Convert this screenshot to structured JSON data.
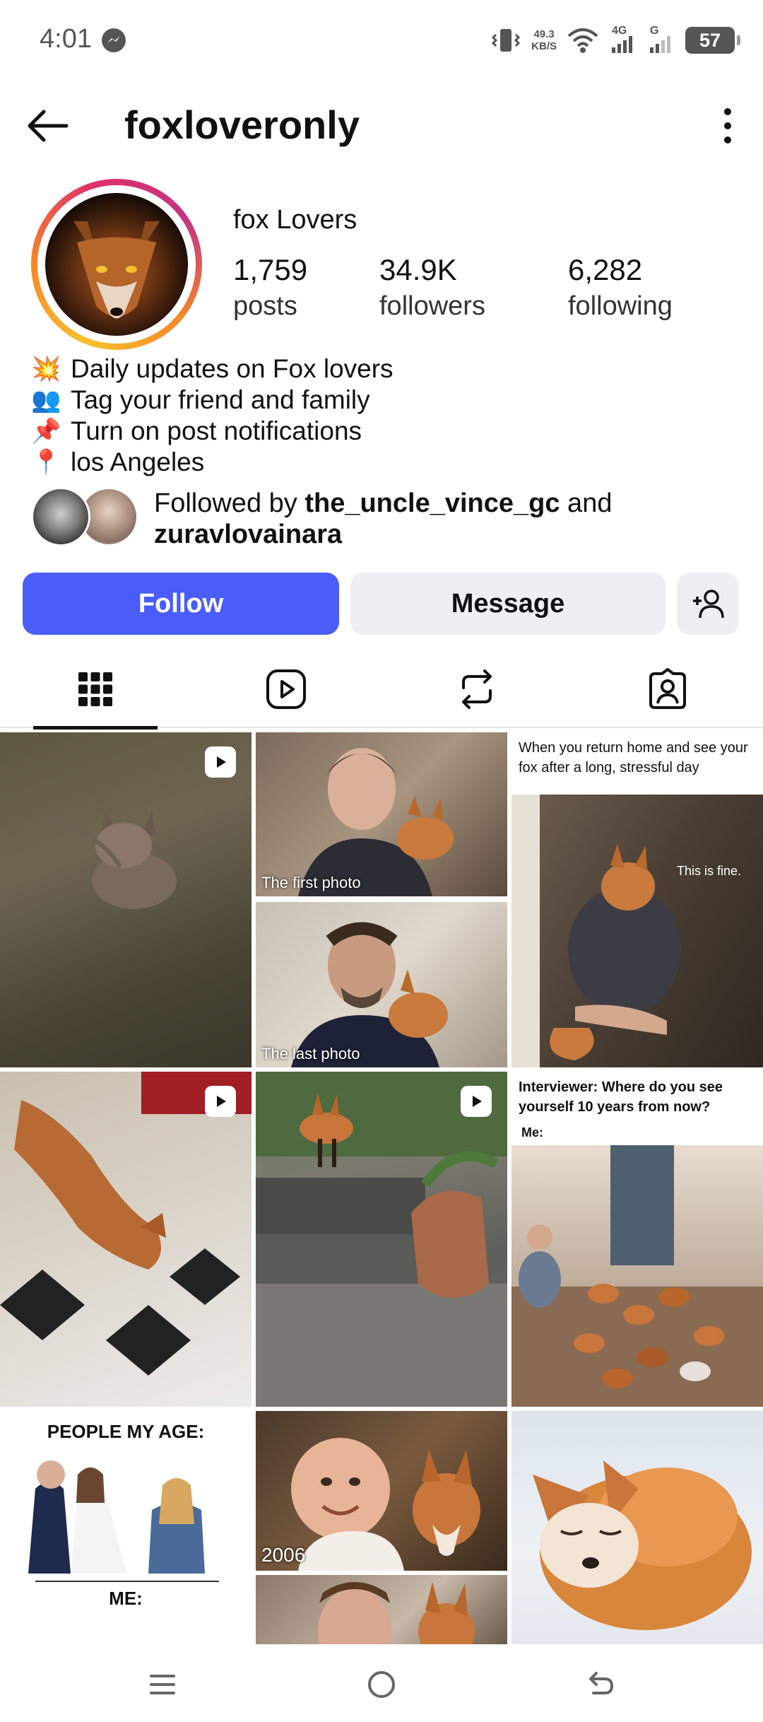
{
  "status_bar": {
    "time": "4:01",
    "net_speed_value": "49.3",
    "net_speed_unit": "KB/S",
    "signal1_label": "4G",
    "signal2_label": "G",
    "battery": "57"
  },
  "header": {
    "username": "foxloveronly"
  },
  "profile": {
    "display_name": "fox Lovers",
    "stats": [
      {
        "value": "1,759",
        "label": "posts"
      },
      {
        "value": "34.9K",
        "label": "followers"
      },
      {
        "value": "6,282",
        "label": "following"
      }
    ],
    "bio": [
      {
        "emoji": "💥",
        "text": "Daily updates on Fox lovers"
      },
      {
        "emoji": "👥",
        "text": "Tag your friend and family"
      },
      {
        "emoji": "📌",
        "text": "Turn on post notifications"
      },
      {
        "emoji": "📍",
        "text": "los Angeles"
      }
    ],
    "followed_by_prefix": "Followed by ",
    "followed_by_user1": "the_uncle_vince_gc",
    "followed_by_and": " and",
    "followed_by_user2": "zuravlovainara"
  },
  "actions": {
    "follow_label": "Follow",
    "message_label": "Message"
  },
  "tabs": [
    {
      "icon": "grid-icon",
      "active": true
    },
    {
      "icon": "reels-icon",
      "active": false
    },
    {
      "icon": "reposts-icon",
      "active": false
    },
    {
      "icon": "tagged-icon",
      "active": false
    }
  ],
  "posts": {
    "p2_top_caption": "The first photo",
    "p2_bottom_caption": "The last photo",
    "p3_meme_text": "When you return home and see your fox after a long, stressful day",
    "p3_overlay": "This is fine.",
    "p6_meme_text": "Interviewer: Where do you see yourself 10 years from now?",
    "p6_me": "Me:",
    "p7_title": "PEOPLE MY AGE:",
    "p7_me": "ME:",
    "p8_caption": "2006"
  },
  "colors": {
    "follow_blue": "#4a5df9",
    "button_gray": "#efeff2"
  }
}
